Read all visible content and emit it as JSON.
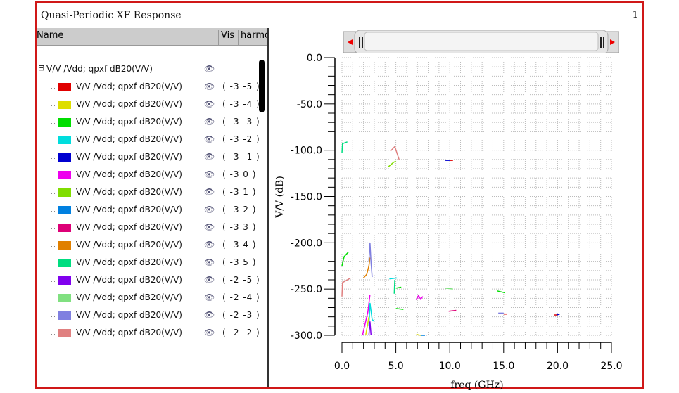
{
  "window": {
    "title": "Quasi-Periodic XF Response",
    "number": "1"
  },
  "table": {
    "headers": {
      "name": "Name",
      "vis": "Vis",
      "harmonic": "harmonic"
    },
    "parent": {
      "label": "V/V /Vdd; qpxf dB20(V/V)"
    },
    "rows": [
      {
        "label": "V/V /Vdd; qpxf dB20(V/V)",
        "harmonic": "( -3 -5 )",
        "color": "#e00000"
      },
      {
        "label": "V/V /Vdd; qpxf dB20(V/V)",
        "harmonic": "( -3 -4 )",
        "color": "#dede00"
      },
      {
        "label": "V/V /Vdd; qpxf dB20(V/V)",
        "harmonic": "( -3 -3 )",
        "color": "#00dd00"
      },
      {
        "label": "V/V /Vdd; qpxf dB20(V/V)",
        "harmonic": "( -3 -2 )",
        "color": "#00dddd"
      },
      {
        "label": "V/V /Vdd; qpxf dB20(V/V)",
        "harmonic": "( -3 -1 )",
        "color": "#0000d0"
      },
      {
        "label": "V/V /Vdd; qpxf dB20(V/V)",
        "harmonic": "( -3 0 )",
        "color": "#ee00ee"
      },
      {
        "label": "V/V /Vdd; qpxf dB20(V/V)",
        "harmonic": "( -3 1 )",
        "color": "#80dd00"
      },
      {
        "label": "V/V /Vdd; qpxf dB20(V/V)",
        "harmonic": "( -3 2 )",
        "color": "#0080e0"
      },
      {
        "label": "V/V /Vdd; qpxf dB20(V/V)",
        "harmonic": "( -3 3 )",
        "color": "#dd0077"
      },
      {
        "label": "V/V /Vdd; qpxf dB20(V/V)",
        "harmonic": "( -3 4 )",
        "color": "#e08000"
      },
      {
        "label": "V/V /Vdd; qpxf dB20(V/V)",
        "harmonic": "( -3 5 )",
        "color": "#00dd80"
      },
      {
        "label": "V/V /Vdd; qpxf dB20(V/V)",
        "harmonic": "( -2 -5 )",
        "color": "#8000ee"
      },
      {
        "label": "V/V /Vdd; qpxf dB20(V/V)",
        "harmonic": "( -2 -4 )",
        "color": "#80e080"
      },
      {
        "label": "V/V /Vdd; qpxf dB20(V/V)",
        "harmonic": "( -2 -3 )",
        "color": "#8080e0"
      },
      {
        "label": "V/V /Vdd; qpxf dB20(V/V)",
        "harmonic": "( -2 -2 )",
        "color": "#e08080"
      }
    ]
  },
  "chart_data": {
    "type": "line",
    "xlabel": "freq (GHz)",
    "ylabel": "V/V (dB)",
    "xlim": [
      0,
      25
    ],
    "ylim": [
      -300,
      0
    ],
    "xticks": [
      "0.0",
      "5.0",
      "10.0",
      "15.0",
      "20.0",
      "25.0"
    ],
    "yticks": [
      "0.0",
      "-50.0",
      "-100.0",
      "-150.0",
      "-200.0",
      "-250.0",
      "-300.0"
    ],
    "grid": true,
    "series": [
      {
        "color": "#00dd80",
        "points": [
          [
            0,
            -103
          ],
          [
            0.05,
            -93
          ],
          [
            0.5,
            -91
          ]
        ]
      },
      {
        "color": "#e08080",
        "points": [
          [
            4.5,
            -101
          ],
          [
            4.9,
            -96
          ],
          [
            5.3,
            -110
          ]
        ]
      },
      {
        "color": "#80dd00",
        "points": [
          [
            4.3,
            -118
          ],
          [
            4.8,
            -113
          ],
          [
            5.0,
            -112
          ]
        ]
      },
      {
        "color": "#0000d0",
        "points": [
          [
            9.6,
            -111
          ],
          [
            10.0,
            -111
          ]
        ]
      },
      {
        "color": "#e00000",
        "points": [
          [
            10.0,
            -111
          ],
          [
            10.3,
            -111
          ]
        ]
      },
      {
        "color": "#00dd00",
        "points": [
          [
            0,
            -225
          ],
          [
            0.2,
            -215
          ],
          [
            0.6,
            -210
          ]
        ]
      },
      {
        "color": "#e08080",
        "points": [
          [
            0,
            -258
          ],
          [
            0.05,
            -243
          ],
          [
            0.8,
            -238
          ]
        ]
      },
      {
        "color": "#e08000",
        "points": [
          [
            2.0,
            -238
          ],
          [
            2.3,
            -234
          ],
          [
            2.5,
            -225
          ],
          [
            2.6,
            -216
          ]
        ]
      },
      {
        "color": "#8080e0",
        "points": [
          [
            2.5,
            -220
          ],
          [
            2.6,
            -200
          ],
          [
            2.7,
            -222
          ],
          [
            2.8,
            -237
          ]
        ]
      },
      {
        "color": "#00dddd",
        "points": [
          [
            4.4,
            -239
          ],
          [
            5.1,
            -238
          ]
        ]
      },
      {
        "color": "#00dd80",
        "points": [
          [
            4.85,
            -255
          ],
          [
            4.9,
            -240
          ]
        ]
      },
      {
        "color": "#00dd00",
        "points": [
          [
            5.0,
            -249
          ],
          [
            5.5,
            -248
          ]
        ]
      },
      {
        "color": "#ee00ee",
        "points": [
          [
            6.9,
            -262
          ],
          [
            7.1,
            -257
          ],
          [
            7.3,
            -261
          ],
          [
            7.5,
            -258
          ]
        ]
      },
      {
        "color": "#80e080",
        "points": [
          [
            9.6,
            -249
          ],
          [
            10.3,
            -250
          ]
        ]
      },
      {
        "color": "#00dd00",
        "points": [
          [
            14.4,
            -252
          ],
          [
            15.1,
            -254
          ]
        ]
      },
      {
        "color": "#00dd00",
        "points": [
          [
            5.0,
            -271
          ],
          [
            5.7,
            -272
          ]
        ]
      },
      {
        "color": "#dd0077",
        "points": [
          [
            9.9,
            -274
          ],
          [
            10.6,
            -273
          ]
        ]
      },
      {
        "color": "#8080e0",
        "points": [
          [
            14.5,
            -276
          ],
          [
            15.0,
            -276
          ]
        ]
      },
      {
        "color": "#e00000",
        "points": [
          [
            15.0,
            -277
          ],
          [
            15.3,
            -277
          ]
        ]
      },
      {
        "color": "#e00000",
        "points": [
          [
            19.7,
            -278
          ],
          [
            20.0,
            -278
          ]
        ]
      },
      {
        "color": "#0000d0",
        "points": [
          [
            19.9,
            -278
          ],
          [
            20.2,
            -277
          ]
        ]
      },
      {
        "color": "#ee00ee",
        "points": [
          [
            1.9,
            -300
          ],
          [
            2.4,
            -275
          ],
          [
            2.6,
            -256
          ]
        ]
      },
      {
        "color": "#00dddd",
        "points": [
          [
            2.5,
            -290
          ],
          [
            2.6,
            -265
          ],
          [
            2.8,
            -283
          ],
          [
            3.0,
            -285
          ]
        ]
      },
      {
        "color": "#dede00",
        "points": [
          [
            2.2,
            -300
          ],
          [
            2.5,
            -280
          ]
        ]
      },
      {
        "color": "#8000ee",
        "points": [
          [
            2.5,
            -300
          ],
          [
            2.6,
            -285
          ],
          [
            2.7,
            -300
          ]
        ]
      },
      {
        "color": "#dede00",
        "points": [
          [
            6.9,
            -299
          ],
          [
            7.3,
            -300
          ]
        ]
      },
      {
        "color": "#0080e0",
        "points": [
          [
            7.3,
            -300
          ],
          [
            7.7,
            -300
          ]
        ]
      }
    ]
  }
}
